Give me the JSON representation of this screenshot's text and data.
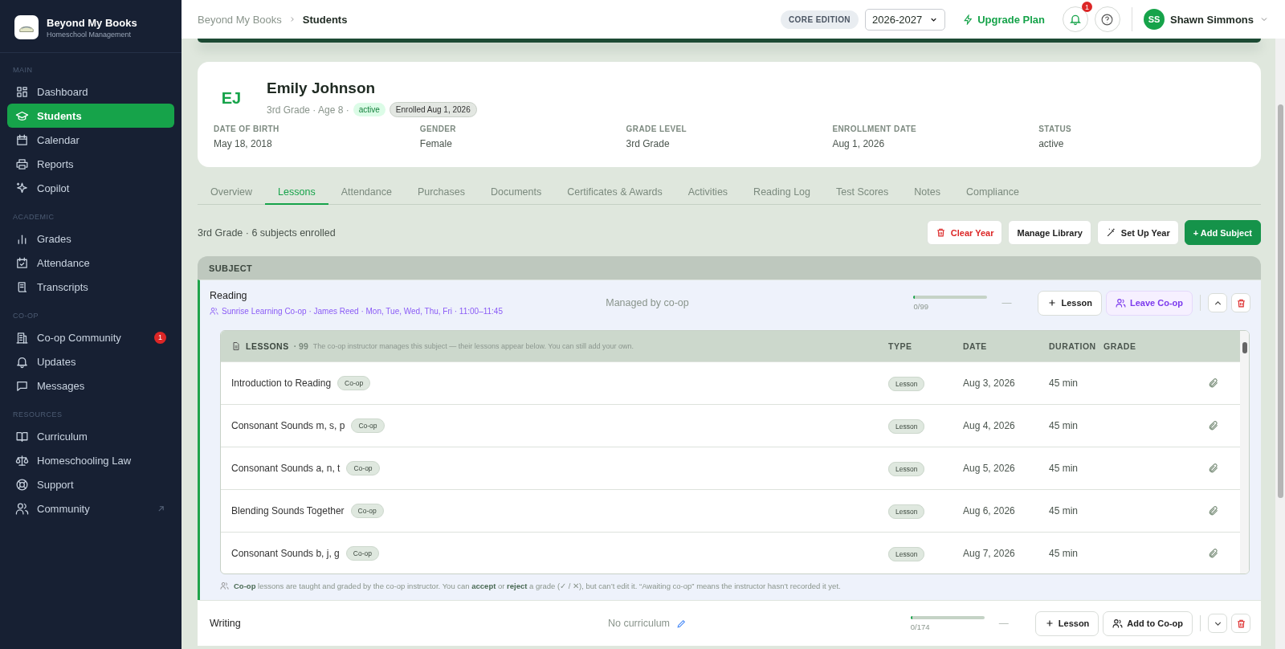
{
  "sidebar": {
    "brand": {
      "title": "Beyond My Books",
      "subtitle": "Homeschool Management"
    },
    "sections": [
      {
        "heading": "MAIN",
        "items": [
          {
            "label": "Dashboard",
            "selected": false,
            "external": false
          },
          {
            "label": "Students",
            "selected": true,
            "external": false
          },
          {
            "label": "Calendar",
            "selected": false,
            "external": false
          },
          {
            "label": "Reports",
            "selected": false,
            "external": false
          },
          {
            "label": "Copilot",
            "selected": false,
            "external": false
          }
        ]
      },
      {
        "heading": "ACADEMIC",
        "items": [
          {
            "label": "Grades",
            "selected": false,
            "external": false
          },
          {
            "label": "Attendance",
            "selected": false,
            "external": false
          },
          {
            "label": "Transcripts",
            "selected": false,
            "external": false
          }
        ]
      },
      {
        "heading": "CO-OP",
        "items": [
          {
            "label": "Co-op Community",
            "selected": false,
            "external": false,
            "badge": "1"
          },
          {
            "label": "Updates",
            "selected": false,
            "external": false
          },
          {
            "label": "Messages",
            "selected": false,
            "external": false
          }
        ]
      },
      {
        "heading": "RESOURCES",
        "items": [
          {
            "label": "Curriculum",
            "selected": false,
            "external": false
          },
          {
            "label": "Homeschooling Law",
            "selected": false,
            "external": false
          },
          {
            "label": "Support",
            "selected": false,
            "external": false
          },
          {
            "label": "Community",
            "selected": false,
            "external": true
          }
        ]
      }
    ]
  },
  "header": {
    "breadcrumb": [
      "Beyond My Books",
      "Students"
    ],
    "edition": "CORE EDITION",
    "year": "2026-2027",
    "upgrade": "Upgrade Plan",
    "notifications": "1",
    "user": {
      "initials": "SS",
      "name": "Shawn Simmons"
    }
  },
  "student": {
    "initials": "EJ",
    "name": "Emily Johnson",
    "summary": "3rd Grade · Age 8 ·",
    "status_badge": "active",
    "enrolled_badge": "Enrolled Aug 1, 2026",
    "details": [
      {
        "label": "DATE OF BIRTH",
        "value": "May 18, 2018"
      },
      {
        "label": "GENDER",
        "value": "Female"
      },
      {
        "label": "GRADE LEVEL",
        "value": "3rd Grade"
      },
      {
        "label": "ENROLLMENT DATE",
        "value": "Aug 1, 2026"
      },
      {
        "label": "STATUS",
        "value": "active"
      }
    ]
  },
  "tabs": [
    {
      "label": "Overview",
      "selected": false
    },
    {
      "label": "Lessons",
      "selected": true
    },
    {
      "label": "Attendance",
      "selected": false
    },
    {
      "label": "Purchases",
      "selected": false
    },
    {
      "label": "Documents",
      "selected": false
    },
    {
      "label": "Certificates & Awards",
      "selected": false
    },
    {
      "label": "Activities",
      "selected": false
    },
    {
      "label": "Reading Log",
      "selected": false
    },
    {
      "label": "Test Scores",
      "selected": false
    },
    {
      "label": "Notes",
      "selected": false
    },
    {
      "label": "Compliance",
      "selected": false
    }
  ],
  "toolbar": {
    "summary": "3rd Grade · 6 subjects enrolled",
    "buttons": [
      {
        "label": "Clear Year",
        "kind": "danger"
      },
      {
        "label": "Manage Library",
        "kind": "plain"
      },
      {
        "label": "Set Up Year",
        "kind": "wand"
      },
      {
        "label": "+ Add Subject",
        "kind": "primary"
      }
    ]
  },
  "subjects": {
    "heading": "SUBJECT",
    "rows": [
      {
        "name": "Reading",
        "expanded": true,
        "coop": "Sunrise Learning Co-op · James Reed · Mon, Tue, Wed, Thu, Fri · 11:00–11:45",
        "curriculum": {
          "text": "Managed by co-op",
          "editable": false
        },
        "progress": "0/99",
        "level": 0,
        "grade": "—",
        "lesson_button": "Lesson",
        "coop_button": {
          "label": "Leave Co-op",
          "kind": "leave"
        },
        "lessons": {
          "title": "LESSONS",
          "count": "· 99",
          "description": "The co-op instructor manages this subject — their lessons appear below. You can still add your own.",
          "columns": [
            "TYPE",
            "DATE",
            "DURATION",
            "GRADE"
          ],
          "rows": [
            {
              "title": "Introduction to Reading",
              "tag": "Co-op",
              "type": "Lesson",
              "date": "Aug 3, 2026",
              "duration": "45 min"
            },
            {
              "title": "Consonant Sounds m, s, p",
              "tag": "Co-op",
              "type": "Lesson",
              "date": "Aug 4, 2026",
              "duration": "45 min"
            },
            {
              "title": "Consonant Sounds a, n, t",
              "tag": "Co-op",
              "type": "Lesson",
              "date": "Aug 5, 2026",
              "duration": "45 min"
            },
            {
              "title": "Blending Sounds Together",
              "tag": "Co-op",
              "type": "Lesson",
              "date": "Aug 6, 2026",
              "duration": "45 min"
            },
            {
              "title": "Consonant Sounds b, j, g",
              "tag": "Co-op",
              "type": "Lesson",
              "date": "Aug 7, 2026",
              "duration": "45 min"
            }
          ]
        },
        "note": "**Co-op** lessons are taught and graded by the co-op instructor. You can **accept** or **reject** a grade (✓ / ✕), but can’t edit it. “Awaiting co-op” means the instructor hasn’t recorded it yet."
      },
      {
        "name": "Writing",
        "expanded": false,
        "curriculum": {
          "text": "No curriculum",
          "editable": true
        },
        "progress": "0/174",
        "level": 0,
        "grade": "—",
        "lesson_button": "Lesson",
        "coop_button": {
          "label": "Add to Co-op",
          "kind": "add"
        }
      }
    ]
  }
}
